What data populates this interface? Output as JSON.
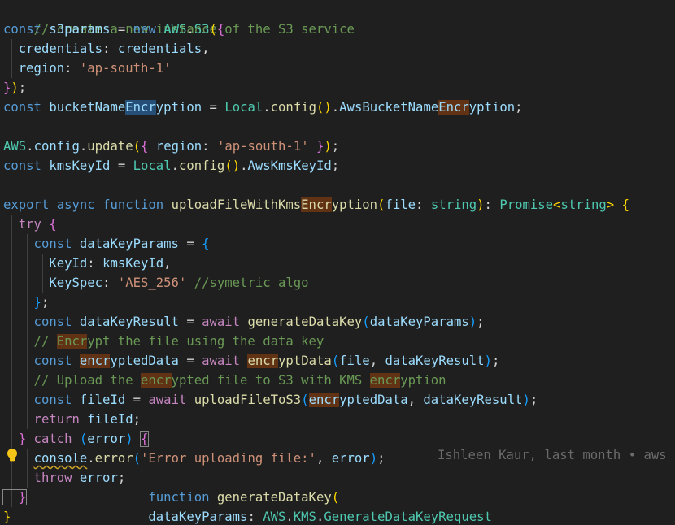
{
  "lines": {
    "l1": "// create a new instance of the S3 service",
    "l2a": "const ",
    "l2b": "s3params",
    "l2c": " = ",
    "l2d": "new ",
    "l2e": "AWS",
    "l2f": ".",
    "l2g": "S3",
    "l2h": "(",
    "l2i": "{",
    "l3a": "  credentials",
    "l3b": ": ",
    "l3c": "credentials",
    "l3d": ",",
    "l4a": "  region",
    "l4b": ": ",
    "l4c": "'ap-south-1'",
    "l5a": "}",
    "l5b": ")",
    "l5c": ";",
    "l6a": "const ",
    "l6b": "bucketName",
    "l6c": "Encr",
    "l6d": "yption",
    "l6e": " = ",
    "l6f": "Local",
    "l6g": ".",
    "l6h": "config",
    "l6i": "()",
    "l6j": ".",
    "l6k": "AwsBucketName",
    "l6l": "Encr",
    "l6m": "yption",
    "l6n": ";",
    "l8a": "AWS",
    "l8b": ".",
    "l8c": "config",
    "l8d": ".",
    "l8e": "update",
    "l8f": "(",
    "l8g": "{ ",
    "l8h": "region",
    "l8i": ": ",
    "l8j": "'ap-south-1'",
    "l8k": " }",
    "l8l": ")",
    "l8m": ";",
    "l9a": "const ",
    "l9b": "kmsKeyId",
    "l9c": " = ",
    "l9d": "Local",
    "l9e": ".",
    "l9f": "config",
    "l9g": "()",
    "l9h": ".",
    "l9i": "AwsKmsKeyId",
    "l9j": ";",
    "l11a": "export ",
    "l11b": "async ",
    "l11c": "function ",
    "l11d": "uploadFileWithKms",
    "l11e": "Encr",
    "l11f": "yption",
    "l11g": "(",
    "l11h": "file",
    "l11i": ": ",
    "l11j": "string",
    "l11k": ")",
    "l11l": ": ",
    "l11m": "Promise",
    "l11n": "<",
    "l11o": "string",
    "l11p": "> ",
    "l11q": "{",
    "l12a": "  try ",
    "l12b": "{",
    "l13a": "    const ",
    "l13b": "dataKeyParams",
    "l13c": " = ",
    "l13d": "{",
    "l14a": "      KeyId",
    "l14b": ": ",
    "l14c": "kmsKeyId",
    "l14d": ",",
    "l15a": "      KeySpec",
    "l15b": ": ",
    "l15c": "'AES_256'",
    "l15d": " //symetric algo",
    "l16a": "    }",
    "l16b": ";",
    "l17a": "    const ",
    "l17b": "dataKeyResult",
    "l17c": " = ",
    "l17d": "await ",
    "l17e": "generateDataKey",
    "l17f": "(",
    "l17g": "dataKeyParams",
    "l17h": ")",
    "l17i": ";",
    "l18a": "    // ",
    "l18b": "Encr",
    "l18c": "ypt the file using the data key",
    "l19a": "    const ",
    "l19b": "encr",
    "l19c": "yptedData",
    "l19d": " = ",
    "l19e": "await ",
    "l19f": "encr",
    "l19g": "yptData",
    "l19h": "(",
    "l19i": "file",
    "l19j": ", ",
    "l19k": "dataKeyResult",
    "l19l": ")",
    "l19m": ";",
    "l20a": "    // Upload the ",
    "l20b": "encr",
    "l20c": "ypted file to S3 with KMS ",
    "l20d": "encr",
    "l20e": "yption",
    "l21a": "    const ",
    "l21b": "fileId",
    "l21c": " = ",
    "l21d": "await ",
    "l21e": "uploadFileToS3",
    "l21f": "(",
    "l21g": "encr",
    "l21h": "yptedData",
    "l21i": ", ",
    "l21j": "dataKeyResult",
    "l21k": ")",
    "l21l": ";",
    "l22a": "    return ",
    "l22b": "fileId",
    "l22c": ";",
    "l23a": "  }",
    "l23b": " catch ",
    "l23c": "(",
    "l23d": "error",
    "l23e": ") ",
    "l23f": "{",
    "l24a": "    ",
    "l24b": "console",
    "l24c": ".",
    "l24d": "error",
    "l24e": "(",
    "l24f": "'Error uploading file:'",
    "l24g": ", ",
    "l24h": "error",
    "l24i": ")",
    "l24j": ";",
    "l25a": "    throw ",
    "l25b": "error",
    "l25c": ";",
    "l26a": "  }",
    "l26b": "                function ",
    "l26c": "generateDataKey",
    "l26d": "(",
    "l27a": "}",
    "l27b": "                  dataKeyParams",
    "l27c": ": ",
    "l27d": "AWS",
    "l27e": ".",
    "l27f": "KMS",
    "l27g": ".",
    "l27h": "GenerateDataKeyRequest"
  },
  "blame": "Ishleen Kaur, last month • aws",
  "icons": {
    "lightbulb": "lightbulb-icon"
  },
  "colors": {
    "background": "#1f1f1f",
    "comment": "#6a9955",
    "keyword": "#569cd6",
    "control": "#c586c0",
    "variable": "#9cdcfe",
    "type": "#4ec9b0",
    "function": "#dcdcaa",
    "string": "#ce9178",
    "find_match_highlight": "#613214",
    "selection_highlight": "#264f78"
  }
}
